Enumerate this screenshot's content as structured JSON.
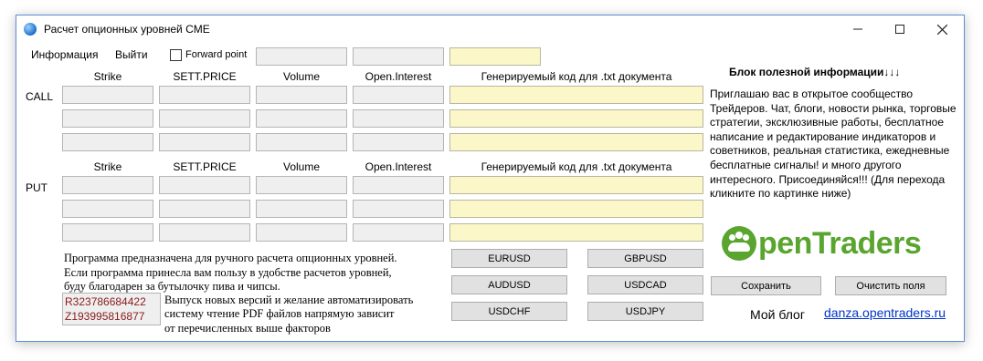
{
  "window": {
    "title": "Расчет опционных уровней CME"
  },
  "menu": {
    "info": "Информация",
    "exit": "Выйти",
    "forward_point": "Forward point"
  },
  "columns": {
    "strike": "Strike",
    "sett_price": "SETT.PRICE",
    "volume": "Volume",
    "open_interest": "Open.Interest",
    "code": "Генерируемый код для .txt документа"
  },
  "rows": {
    "call": "CALL",
    "put": "PUT"
  },
  "info": {
    "title": "Блок полезной информации↓↓↓",
    "text": "Приглашаю вас в открытое сообщество Трейдеров.  Чат, блоги, новости рынка, торговые стратегии, эксклюзивные работы, бесплатное написание и редактирование индикаторов и советников,  реальная статистика, ежедневные бесплатные сигналы! и много другого интересного. Присоединяйся!!! (Для перехода кликните по картинке ниже)",
    "logo_text": "penTraders"
  },
  "currency_buttons": [
    "EURUSD",
    "GBPUSD",
    "AUDUSD",
    "USDCAD",
    "USDCHF",
    "USDJPY"
  ],
  "actions": {
    "save": "Сохранить",
    "clear": "Очистить поля"
  },
  "description": {
    "line1": "Программа предназначена для ручного расчета опционных уровней.",
    "line2": "Если программа принесла вам пользу в удобстве расчетов уровней,",
    "line3": "буду благодарен за бутылочку пива и чипсы.",
    "line4": "Выпуск новых версий и желание автоматизировать",
    "line5": "систему чтение PDF файлов напрямую зависит",
    "line6": "от перечисленных  выше факторов"
  },
  "wallets": [
    "R323786684422",
    "Z193995816877"
  ],
  "blog": {
    "label": "Мой блог",
    "link": "danza.opentraders.ru"
  },
  "colors": {
    "yellow_field": "#fcf7c8",
    "gray_field": "#efefef",
    "logo_green": "#5aa52f",
    "link": "#0033cc",
    "wallet_text": "#8b1a1a"
  }
}
